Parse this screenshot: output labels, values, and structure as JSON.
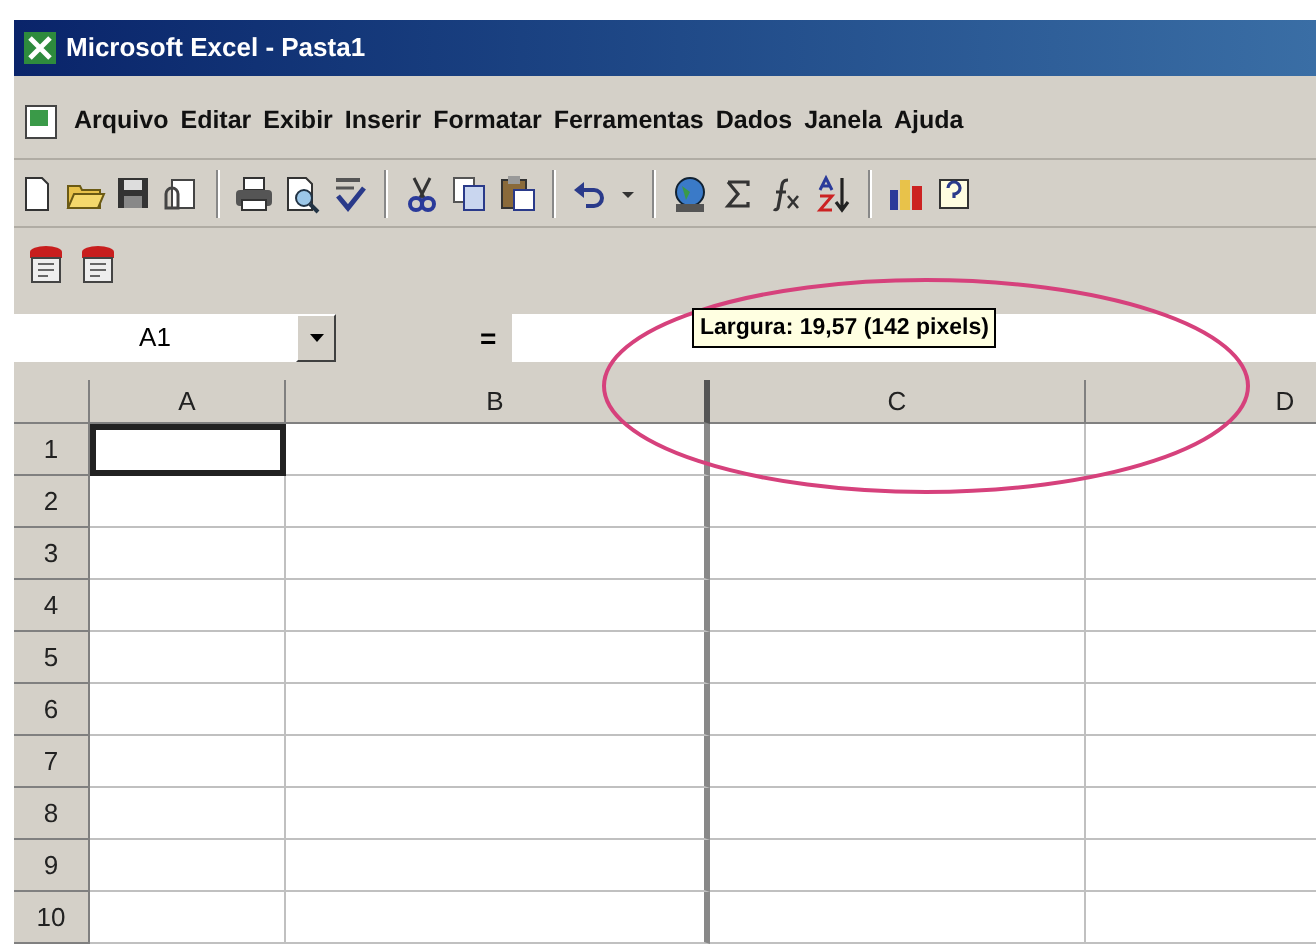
{
  "window": {
    "title": "Microsoft Excel - Pasta1"
  },
  "menu": [
    {
      "label": "Arquivo"
    },
    {
      "label": "Editar"
    },
    {
      "label": "Exibir"
    },
    {
      "label": "Inserir"
    },
    {
      "label": "Formatar"
    },
    {
      "label": "Ferramentas"
    },
    {
      "label": "Dados"
    },
    {
      "label": "Janela"
    },
    {
      "label": "Ajuda"
    }
  ],
  "toolbar": [
    {
      "kind": "new"
    },
    {
      "kind": "open"
    },
    {
      "kind": "save"
    },
    {
      "kind": "permission"
    },
    {
      "kind": "separator"
    },
    {
      "kind": "print"
    },
    {
      "kind": "preview"
    },
    {
      "kind": "spelling"
    },
    {
      "kind": "separator"
    },
    {
      "kind": "cut"
    },
    {
      "kind": "copy"
    },
    {
      "kind": "paste"
    },
    {
      "kind": "separator"
    },
    {
      "kind": "undo"
    },
    {
      "kind": "dropdown"
    },
    {
      "kind": "separator"
    },
    {
      "kind": "web"
    },
    {
      "kind": "autosum"
    },
    {
      "kind": "function"
    },
    {
      "kind": "sort"
    },
    {
      "kind": "separator"
    },
    {
      "kind": "chart"
    },
    {
      "kind": "help"
    }
  ],
  "toolbar_2": [
    {
      "kind": "form"
    },
    {
      "kind": "form"
    }
  ],
  "formula_bar": {
    "name_box": "A1",
    "equals": "="
  },
  "tooltip": {
    "text": "Largura: 19,57 (142 pixels)"
  },
  "columns": [
    {
      "label": "A"
    },
    {
      "label": "B"
    },
    {
      "label": "C"
    },
    {
      "label": "D"
    }
  ],
  "rows": [
    {
      "label": "1",
      "cells": [
        {
          "selected": true
        },
        {
          "selected": false
        },
        {
          "selected": false
        },
        {
          "selected": false
        }
      ]
    },
    {
      "label": "2",
      "cells": [
        {
          "selected": false
        },
        {
          "selected": false
        },
        {
          "selected": false
        },
        {
          "selected": false
        }
      ]
    },
    {
      "label": "3",
      "cells": [
        {
          "selected": false
        },
        {
          "selected": false
        },
        {
          "selected": false
        },
        {
          "selected": false
        }
      ]
    },
    {
      "label": "4",
      "cells": [
        {
          "selected": false
        },
        {
          "selected": false
        },
        {
          "selected": false
        },
        {
          "selected": false
        }
      ]
    },
    {
      "label": "5",
      "cells": [
        {
          "selected": false
        },
        {
          "selected": false
        },
        {
          "selected": false
        },
        {
          "selected": false
        }
      ]
    },
    {
      "label": "6",
      "cells": [
        {
          "selected": false
        },
        {
          "selected": false
        },
        {
          "selected": false
        },
        {
          "selected": false
        }
      ]
    },
    {
      "label": "7",
      "cells": [
        {
          "selected": false
        },
        {
          "selected": false
        },
        {
          "selected": false
        },
        {
          "selected": false
        }
      ]
    },
    {
      "label": "8",
      "cells": [
        {
          "selected": false
        },
        {
          "selected": false
        },
        {
          "selected": false
        },
        {
          "selected": false
        }
      ]
    },
    {
      "label": "9",
      "cells": [
        {
          "selected": false
        },
        {
          "selected": false
        },
        {
          "selected": false
        },
        {
          "selected": false
        }
      ]
    },
    {
      "label": "10",
      "cells": [
        {
          "selected": false
        },
        {
          "selected": false
        },
        {
          "selected": false
        },
        {
          "selected": false
        }
      ]
    }
  ]
}
